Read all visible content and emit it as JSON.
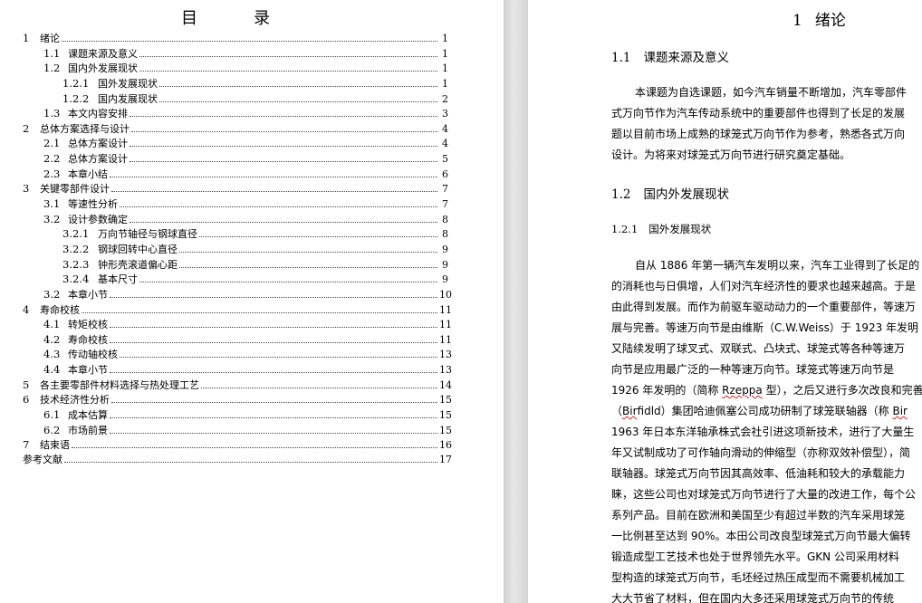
{
  "toc": {
    "title": "目　录",
    "entries": [
      {
        "num": "1",
        "label": "绪论",
        "page": "1",
        "level": 1
      },
      {
        "num": "1.1",
        "label": "课题来源及意义",
        "page": "1",
        "level": 2
      },
      {
        "num": "1.2",
        "label": "国内外发展现状",
        "page": "1",
        "level": 2
      },
      {
        "num": "1.2.1",
        "label": "国外发展现状",
        "page": "1",
        "level": 3
      },
      {
        "num": "1.2.2",
        "label": "国内发展现状",
        "page": "2",
        "level": 3
      },
      {
        "num": "1.3",
        "label": "本文内容安排",
        "page": "3",
        "level": 2
      },
      {
        "num": "2",
        "label": "总体方案选择与设计",
        "page": "4",
        "level": 1
      },
      {
        "num": "2.1",
        "label": "总体方案设计",
        "page": "4",
        "level": 2
      },
      {
        "num": "2.2",
        "label": "总体方案设计",
        "page": "5",
        "level": 2
      },
      {
        "num": "2.3",
        "label": "本章小结",
        "page": "6",
        "level": 2
      },
      {
        "num": "3",
        "label": "关键零部件设计",
        "page": "7",
        "level": 1
      },
      {
        "num": "3.1",
        "label": "等速性分析",
        "page": "7",
        "level": 2
      },
      {
        "num": "3.2",
        "label": "设计参数确定",
        "page": "8",
        "level": 2
      },
      {
        "num": "3.2.1",
        "label": "万向节轴径与钢球直径",
        "page": "8",
        "level": 3
      },
      {
        "num": "3.2.2",
        "label": "钢球回转中心直径",
        "page": "9",
        "level": 3
      },
      {
        "num": "3.2.3",
        "label": "钟形壳滚道偏心距",
        "page": "9",
        "level": 3
      },
      {
        "num": "3.2.4",
        "label": "基本尺寸",
        "page": "9",
        "level": 3
      },
      {
        "num": "3.2",
        "label": "本章小节",
        "page": "10",
        "level": 2
      },
      {
        "num": "4",
        "label": "寿命校核",
        "page": "11",
        "level": 1
      },
      {
        "num": "4.1",
        "label": "转矩校核",
        "page": "11",
        "level": 2
      },
      {
        "num": "4.2",
        "label": "寿命校核",
        "page": "11",
        "level": 2
      },
      {
        "num": "4.3",
        "label": "传动轴校核",
        "page": "13",
        "level": 2
      },
      {
        "num": "4.4",
        "label": "本章小节",
        "page": "13",
        "level": 2
      },
      {
        "num": "5",
        "label": "各主要零部件材料选择与热处理工艺",
        "page": "14",
        "level": 1
      },
      {
        "num": "6",
        "label": "技术经济性分析",
        "page": "15",
        "level": 1
      },
      {
        "num": "6.1",
        "label": "成本估算",
        "page": "15",
        "level": 2
      },
      {
        "num": "6.2",
        "label": "市场前景",
        "page": "15",
        "level": 2
      },
      {
        "num": "7",
        "label": "结束语",
        "page": "16",
        "level": 1
      },
      {
        "num": "",
        "label": "参考文献",
        "page": "17",
        "level": 0
      }
    ]
  },
  "body": {
    "chapter": {
      "num": "1",
      "title": "绪论"
    },
    "s11": {
      "num": "1.1",
      "title": "课题来源及意义"
    },
    "p1": [
      "本课题为自选课题，如今汽车销量不断增加，汽车零部件",
      "式万向节作为汽车传动系统中的重要部件也得到了长足的发展",
      "题以目前市场上成熟的球笼式万向节作为参考，熟悉各式万向",
      "设计。为将来对球笼式万向节进行研究奠定基础。"
    ],
    "s12": {
      "num": "1.2",
      "title": "国内外发展现状"
    },
    "s121": {
      "num": "1.2.1",
      "title": "国外发展现状"
    },
    "p2": [
      "自从 1886 年第一辆汽车发明以来，汽车工业得到了长足的",
      "的消耗也与日俱增，人们对汽车经济性的要求也越来越高。于是",
      "由此得到发展。而作为前驱车驱动动力的一个重要部件，等速万",
      "展与完善。等速万向节是由维斯（C.W.Weiss）于 1923 年发明",
      "又陆续发明了球叉式、双联式、凸块式、球笼式等各种等速万",
      "向节是应用最广泛的一种等速万向节。球笼式等速万向节是",
      "1926 年发明的（简称 Rzeppa 型），之后又进行多次改良和完善",
      "（Birfidld）集团哈迪佩塞公司成功研制了球笼联轴器（称 Bir",
      "1963 年日本东洋轴承株式会社引进这项新技术，进行了大量生",
      "年又试制成功了可作轴向滑动的伸缩型（亦称双效补偿型），简",
      "联轴器。球笼式万向节因其高效率、低油耗和较大的承载能力",
      "睐，这些公司也对球笼式万向节进行了大量的改进工作，每个公",
      "系列产品。目前在欧洲和美国至少有超过半数的汽车采用球笼",
      "一比例甚至达到 90%。本田公司改良型球笼式万向节最大偏转",
      "锻造成型工艺技术也处于世界领先水平。GKN 公司采用材料",
      "型构造的球笼式万向节，毛坯经过热压成型而不需要机械加工",
      "大大节省了材料，但在国内大多还采用球笼式万向节的传统"
    ]
  }
}
